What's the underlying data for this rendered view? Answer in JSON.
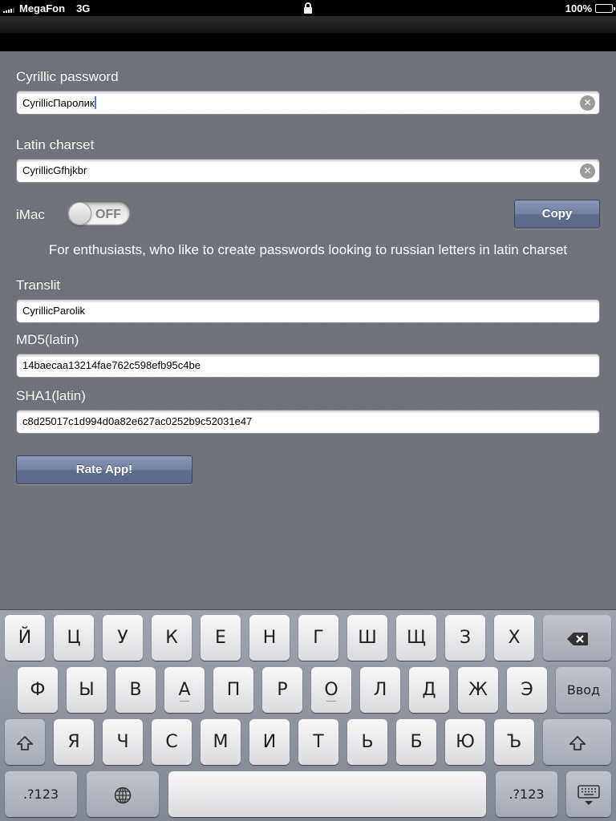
{
  "status_bar": {
    "carrier": "MegaFon",
    "network": "3G",
    "battery": "100%",
    "battery_level": 1.0
  },
  "form": {
    "cyrillic_password": {
      "label": "Cyrillic password",
      "value": "CyrillicПаролик"
    },
    "latin_charset": {
      "label": "Latin charset",
      "value": "CyrillicGfhjkbr"
    },
    "imac": {
      "label": "iMac",
      "toggle_text": "OFF",
      "on": false
    },
    "copy_button": "Copy",
    "description": "For enthusiasts, who like to create passwords looking to russian letters in latin charset",
    "translit": {
      "label": "Translit",
      "value": "CyrillicParolik"
    },
    "md5": {
      "label": "MD5(latin)",
      "value": "14baecaa13214fae762c598efb95c4be"
    },
    "sha1": {
      "label": "SHA1(latin)",
      "value": "c8d25017c1d994d0a82e627ac0252b9c52031e47"
    },
    "rate_button": "Rate App!"
  },
  "keyboard": {
    "row1": [
      "Й",
      "Ц",
      "У",
      "К",
      "Е",
      "Н",
      "Г",
      "Ш",
      "Щ",
      "З",
      "Х"
    ],
    "row2": [
      "Ф",
      "Ы",
      "В",
      "А",
      "П",
      "Р",
      "О",
      "Л",
      "Д",
      "Ж",
      "Э"
    ],
    "return_key": "Ввод",
    "row3": [
      "Я",
      "Ч",
      "С",
      "М",
      "И",
      "Т",
      "Ь",
      "Б",
      "Ю",
      "Ъ"
    ],
    "numbers_key": ".?123",
    "icons": {
      "backspace": "backspace-icon",
      "shift": "shift-icon",
      "globe": "globe-icon",
      "dismiss": "keyboard-dismiss-icon"
    }
  }
}
